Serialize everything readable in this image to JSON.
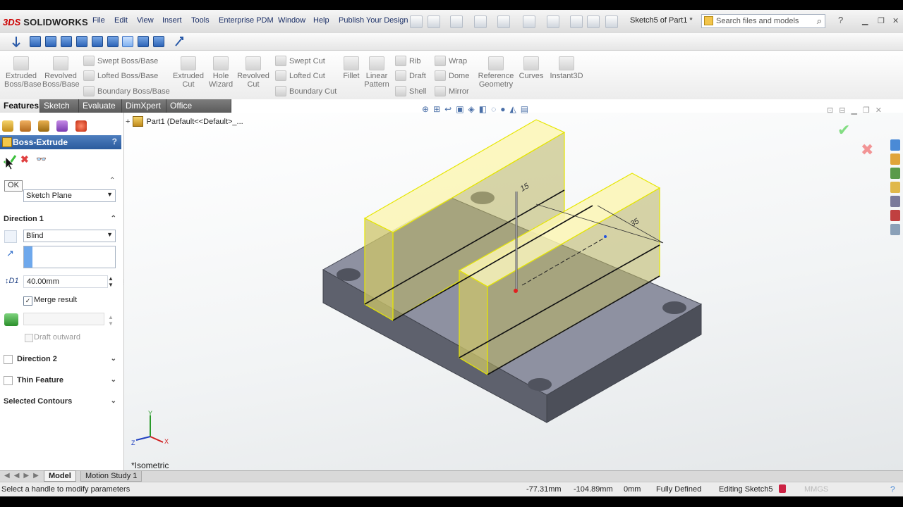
{
  "app": {
    "logo_mark": "3DS",
    "name": "SOLIDWORKS"
  },
  "menu": [
    "File",
    "Edit",
    "View",
    "Insert",
    "Tools",
    "Enterprise PDM",
    "Window",
    "Help",
    "Publish Your Design"
  ],
  "doc_title": "Sketch5 of Part1 *",
  "search": {
    "placeholder": "Search files and models"
  },
  "help_label": "?",
  "features_toolbar": {
    "extruded_boss": "Extruded Boss/Base",
    "revolved_boss": "Revolved Boss/Base",
    "swept_boss": "Swept Boss/Base",
    "lofted_boss": "Lofted Boss/Base",
    "boundary_boss": "Boundary Boss/Base",
    "extruded_cut": "Extruded Cut",
    "hole_wizard": "Hole Wizard",
    "revolved_cut": "Revolved Cut",
    "swept_cut": "Swept Cut",
    "lofted_cut": "Lofted Cut",
    "boundary_cut": "Boundary Cut",
    "fillet": "Fillet",
    "linear_pattern": "Linear Pattern",
    "rib": "Rib",
    "draft": "Draft",
    "shell": "Shell",
    "wrap": "Wrap",
    "dome": "Dome",
    "mirror": "Mirror",
    "reference_geometry": "Reference Geometry",
    "curves": "Curves",
    "instant3d": "Instant3D"
  },
  "tabs": [
    "Features",
    "Sketch",
    "Evaluate",
    "DimXpert",
    "Office Products"
  ],
  "property_manager": {
    "title": "Boss-Extrude",
    "help": "?",
    "ok_tooltip": "OK",
    "from_value": "Sketch Plane",
    "direction1": {
      "label": "Direction 1",
      "end_condition": "Blind",
      "depth": "40.00mm",
      "merge_result": "Merge result",
      "merge_checked": true,
      "draft_outward": "Draft outward",
      "draft_checked": false
    },
    "direction2": "Direction 2",
    "thin_feature": "Thin Feature",
    "selected_contours": "Selected Contours"
  },
  "tree_root": "Part1  (Default<<Default>_...",
  "dimensions": [
    "15",
    "35"
  ],
  "view_name": "*Isometric",
  "triad": {
    "x": "X",
    "y": "Y",
    "z": "Z"
  },
  "bottom_tabs": [
    "Model",
    "Motion Study 1"
  ],
  "status": {
    "message": "Select a handle to modify parameters",
    "x": "-77.31mm",
    "y": "-104.89mm",
    "z": "0mm",
    "state": "Fully Defined",
    "editing": "Editing Sketch5",
    "units": "MMGS"
  },
  "colors": {
    "preview_yellow": "#f2f200",
    "part_gray": "#6b6f7c",
    "pm_header": "#3b6aaa",
    "accept_green": "#3bbf3b",
    "cancel_red": "#e04040"
  }
}
